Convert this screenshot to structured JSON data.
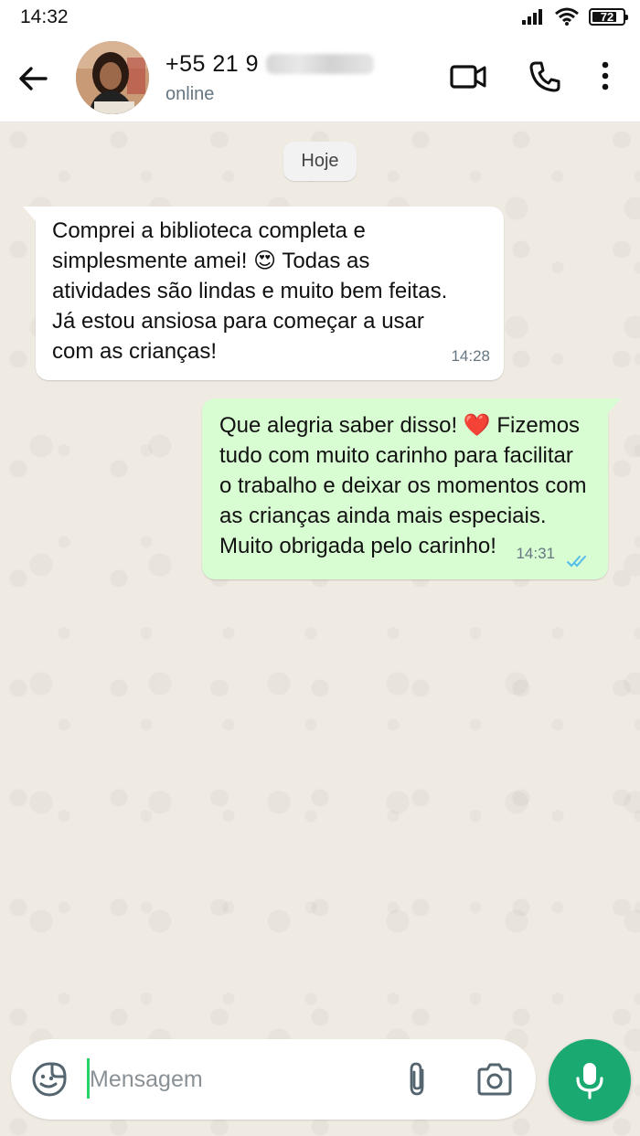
{
  "status_bar": {
    "time": "14:32",
    "battery": "72"
  },
  "header": {
    "contact_name": "+55 21 9",
    "contact_status": "online"
  },
  "chat": {
    "date_chip": "Hoje",
    "messages": [
      {
        "direction": "incoming",
        "text": "Comprei a biblioteca completa e\nsimplesmente amei! 😍 Todas as\natividades são lindas e muito bem feitas.\nJá estou ansiosa para começar a usar\ncom as crianças!",
        "time": "14:28"
      },
      {
        "direction": "outgoing",
        "text": "Que alegria saber disso! ❤️ Fizemos\ntudo com muito carinho para facilitar\no trabalho e deixar os momentos com\nas crianças ainda mais especiais.\nMuito obrigada pelo carinho!",
        "time": "14:31",
        "status": "read"
      }
    ]
  },
  "composer": {
    "placeholder": "Mensagem"
  },
  "colors": {
    "outgoing_bubble": "#d9fdd3",
    "incoming_bubble": "#ffffff",
    "accent": "#1aaa71",
    "read_ticks": "#53bdeb",
    "wallpaper": "#efeae2"
  },
  "icons": [
    "back-arrow-icon",
    "video-call-icon",
    "phone-icon",
    "more-options-icon",
    "sticker-icon",
    "attach-icon",
    "camera-icon",
    "mic-icon",
    "double-check-icon",
    "signal-icon",
    "wifi-icon",
    "battery-icon"
  ]
}
